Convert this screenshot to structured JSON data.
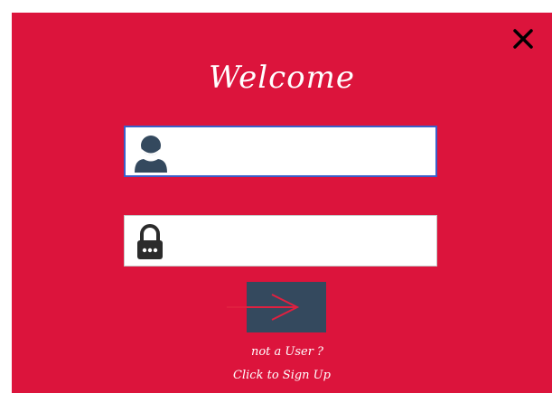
{
  "window": {
    "background_color": "#dc143c",
    "close_icon": "close-icon"
  },
  "header": {
    "title": "Welcome"
  },
  "form": {
    "username": {
      "icon": "user-icon",
      "value": "",
      "placeholder": ""
    },
    "password": {
      "icon": "lock-icon",
      "value": "",
      "placeholder": ""
    },
    "submit": {
      "icon": "arrow-right-icon",
      "button_color": "#34495e",
      "arrow_color": "#e02040"
    }
  },
  "signup": {
    "question": "not a User ?",
    "link": "Click to Sign Up"
  }
}
